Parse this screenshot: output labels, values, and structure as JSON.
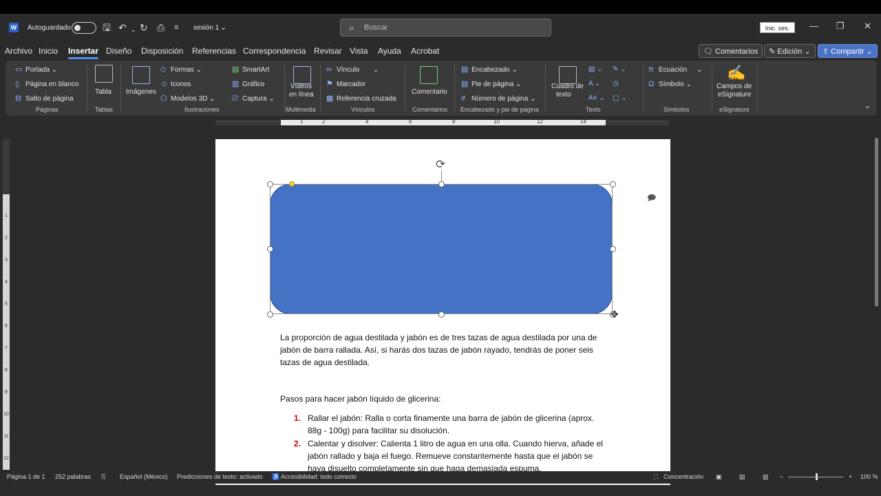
{
  "titlebar": {
    "autosave_label": "Autoguardado",
    "doc_title": "sesión 1",
    "search_placeholder": "Buscar",
    "signin_label": "Inic. ses."
  },
  "menu": {
    "tabs": [
      "Archivo",
      "Inicio",
      "Insertar",
      "Diseño",
      "Disposición",
      "Referencias",
      "Correspondencia",
      "Revisar",
      "Vista",
      "Ayuda",
      "Acrobat"
    ],
    "active_tab": "Insertar",
    "comments_label": "Comentarios",
    "editing_label": "Edición",
    "share_label": "Compartir"
  },
  "ribbon": {
    "paginas": {
      "cover": "Portada",
      "blank": "Página en blanco",
      "break": "Salto de página",
      "label": "Páginas"
    },
    "tablas": {
      "table": "Tabla",
      "label": "Tablas"
    },
    "ilustraciones": {
      "images": "Imágenes",
      "shapes": "Formas",
      "icons": "Iconos",
      "models": "Modelos 3D",
      "smartart": "SmartArt",
      "chart": "Gráfico",
      "capture": "Captura",
      "label": "Ilustraciones"
    },
    "multimedia": {
      "video1": "Vídeos",
      "video2": "en línea",
      "label": "Multimedia"
    },
    "vinculos": {
      "link": "Vínculo",
      "bookmark": "Marcador",
      "crossref": "Referencia cruzada",
      "label": "Vínculos"
    },
    "comentarios": {
      "comment": "Comentario",
      "label": "Comentarios"
    },
    "encabezado": {
      "header": "Encabezado",
      "footer": "Pie de página",
      "pagenum": "Número de página",
      "label": "Encabezado y pie de página"
    },
    "texto": {
      "textbox1": "Cuadro de",
      "textbox2": "texto",
      "label": "Texto"
    },
    "simbolos": {
      "equation": "Ecuación",
      "symbol": "Símbolo",
      "label": "Símbolos"
    },
    "esignature": {
      "fields1": "Campos de",
      "fields2": "eSignature",
      "label": "eSignature"
    }
  },
  "ruler": {
    "numbers": [
      "1",
      "2",
      "4",
      "6",
      "8",
      "10",
      "12",
      "14"
    ]
  },
  "vruler": {
    "numbers": [
      "1",
      "2",
      "3",
      "4",
      "5",
      "6",
      "7",
      "8",
      "9",
      "10",
      "11",
      "12"
    ]
  },
  "document": {
    "para1_lines": [
      "La proporción de agua destilada y jabón es de tres tazas de agua destilada por una de",
      "jabón de barra rallada. Así, si harás dos tazas de jabón rayado, tendrás de poner seis",
      "tazas de agua destilada."
    ],
    "heading": "Pasos para hacer jabón líquido de glicerina:",
    "list": [
      {
        "num": "1.",
        "lines": [
          "Rallar el jabón: Ralla o corta finamente una barra de jabón de glicerina (aprox.",
          "88g - 100g) para facilitar su disolución."
        ]
      },
      {
        "num": "2.",
        "lines": [
          "Calentar y disolver: Calienta 1 litro de agua en una olla. Cuando hierva, añade el",
          "jabón rallado y baja el fuego. Remueve constantemente hasta que el jabón se",
          "haya disuelto completamente sin que haga demasiada espuma."
        ]
      }
    ]
  },
  "status": {
    "page": "Página 1 de 1",
    "words": "252 palabras",
    "language": "Español (México)",
    "predictions": "Predicciones de texto: activado",
    "accessibility": "Accesibilidad: todo correcto",
    "focus": "Concentración",
    "zoom": "100 %"
  },
  "colors": {
    "shape_fill": "#4472c4",
    "accent": "#4f8ff5",
    "list_number": "#c00000"
  }
}
